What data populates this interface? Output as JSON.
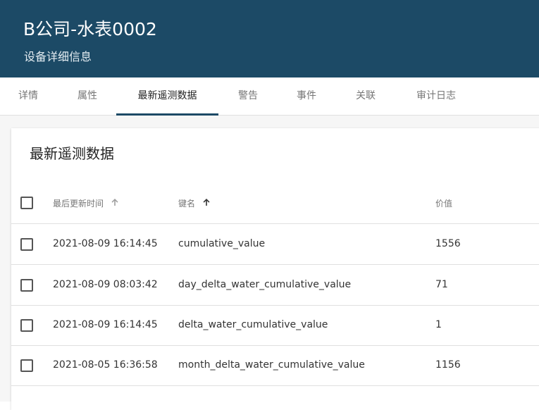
{
  "header": {
    "title": "B公司-水表0002",
    "subtitle": "设备详细信息"
  },
  "tabs": [
    {
      "label": "详情",
      "active": false
    },
    {
      "label": "属性",
      "active": false
    },
    {
      "label": "最新遥测数据",
      "active": true
    },
    {
      "label": "警告",
      "active": false
    },
    {
      "label": "事件",
      "active": false
    },
    {
      "label": "关联",
      "active": false
    },
    {
      "label": "审计日志",
      "active": false
    }
  ],
  "card": {
    "title": "最新遥测数据"
  },
  "table": {
    "columns": {
      "time": "最后更新时间",
      "key": "键名",
      "value": "价值"
    },
    "rows": [
      {
        "time": "2021-08-09 16:14:45",
        "key": "cumulative_value",
        "value": "1556"
      },
      {
        "time": "2021-08-09 08:03:42",
        "key": "day_delta_water_cumulative_value",
        "value": "71"
      },
      {
        "time": "2021-08-09 16:14:45",
        "key": "delta_water_cumulative_value",
        "value": "1"
      },
      {
        "time": "2021-08-05 16:36:58",
        "key": "month_delta_water_cumulative_value",
        "value": "1156"
      }
    ]
  },
  "colors": {
    "header_bg": "#1c4a66",
    "tab_indicator": "#1c4a66"
  },
  "icons": {
    "time_sort": "arrow-up-icon",
    "key_sort": "arrow-up-icon"
  }
}
